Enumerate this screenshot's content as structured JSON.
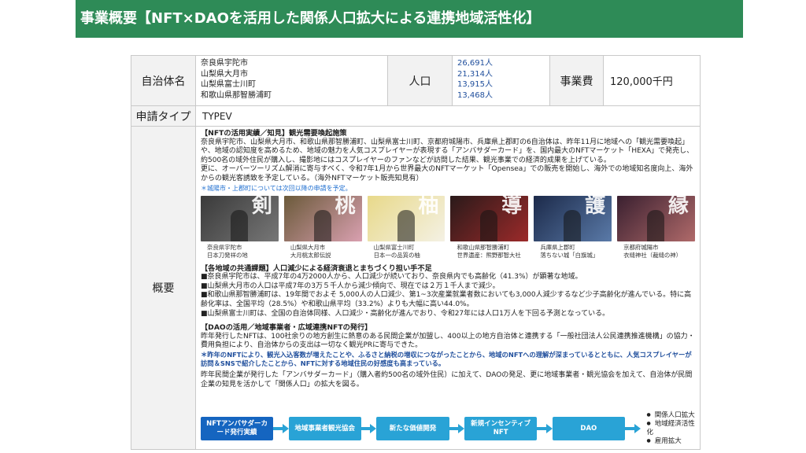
{
  "header": {
    "title": "事業概要【NFT×DAOを活用した関係人口拡大による連携地域活性化】"
  },
  "table": {
    "municipality_label": "自治体名",
    "municipalities": [
      "奈良県宇陀市",
      "山梨県大月市",
      "山梨県富士川町",
      "和歌山県那智勝浦町"
    ],
    "population_label": "人口",
    "populations": [
      "26,691人",
      "21,314人",
      "13,915人",
      "13,468人"
    ],
    "budget_label": "事業費",
    "budget_value": "120,000千円",
    "type_label": "申請タイプ",
    "type_value": "TYPEV",
    "overview_label": "概要"
  },
  "overview": {
    "s1_title": "【NFTの活用実績／知見】観光需要喚起施策",
    "s1_p1": "奈良県宇陀市、山梨県大月市、和歌山県那智勝浦町、山梨県富士川町、京都府城陽市、兵庫県上郡町の6自治体は、昨年11月に地域への「観光需要喚起」や、地域の認知度を高めるため、地域の魅力を人気コスプレイヤーが表現する「アンバサダーカード」を、国内最大のNFTマーケット「HEXA」で発売し、約500名の域外住民が購入し、撮影地にはコスプレイヤーのファンなどが訪問した結果、観光事業での経済的成果を上げている。",
    "s1_p2": "更に、オーバーツーリズム解消に寄与すべく、令和7年1月から世界最大のNFTマーケット「Opensea」での販売を開始し、海外での地域知名度向上、海外からの観光客誘致を予定している。（海外NFTマーケット販売知見有）",
    "s1_note": "＊城陽市・上郡町については次回以降の申請を予定。",
    "photos": [
      {
        "kanji": "剣",
        "caption1": "奈良県宇陀市",
        "caption2": "日本刀発祥の地",
        "c1": "#3a3a3a",
        "c2": "#777777"
      },
      {
        "kanji": "桃",
        "caption1": "山梨県大月市",
        "caption2": "大月桃太郎伝説",
        "c1": "#6b5a3a",
        "c2": "#d9a0b0"
      },
      {
        "kanji": "柚",
        "caption1": "山梨県富士川町",
        "caption2": "日本一の品質の柚",
        "c1": "#e8d98a",
        "c2": "#f4f1e4"
      },
      {
        "kanji": "導",
        "caption1": "和歌山県那智勝浦町",
        "caption2": "世界遺産：熊野那智大社",
        "c1": "#2a1a1a",
        "c2": "#9c2a2a"
      },
      {
        "kanji": "護",
        "caption1": "兵庫県上郡町",
        "caption2": "落ちない城「白旗城」",
        "c1": "#1c2a4a",
        "c2": "#5a7aa8"
      },
      {
        "kanji": "縁",
        "caption1": "京都府城陽市",
        "caption2": "衣縫神社（裁縫の神）",
        "c1": "#3a2030",
        "c2": "#b06a6a"
      }
    ],
    "s2_title": "【各地域の共通課題】人口減少による経済衰退とまちづくり担い手不足",
    "s2_items": [
      "■奈良県宇陀市は、平成7年の4万2000人から、人口減少が続いており、奈良県内でも高齢化（41.3%）が顕著な地域。",
      "■山梨県大月市の人口は平成7年の3万５千人から減少傾向で、現在では２万１千人まで減少。",
      "■和歌山県那智勝浦町は、19年間でおよそ 5,000人の人口減少、第1~3次産業就業者数においても3,000人減少するなど少子高齢化が進んでいる。特に高齢化率は、全国平均（28.5%）や和歌山県平均（33.2%）よりも大幅に高い44.0%。",
      "■山梨県富士川町は、全国の自治体同様、人口減少・高齢化が進んでおり、令和27年には人口1万人を下回る予測となっている。"
    ],
    "s3_title": "【DAOの活用／地域事業者・広域連携NFTの発行】",
    "s3_p1": "昨年発行したNFTは、100社余りの地方創生に熱意のある民間企業が加盟し、400以上の地方自治体と連携する「一般社団法人公民連携推進機構」の協力・費用負担により、自治体からの支出は一切なく観光PRに寄与できた。",
    "s3_note": "＊昨年のNFTにより、観光入込客数が増えたことや、ふるさと納税の増収につながったことから、地域のNFTへの理解が深まっているとともに、人気コスプレイヤーが訪問＆SNSで紹介したことから、NFTに対する地域住民の好感度も高まっている。",
    "s3_p2": "昨年民間企業が発行した「アンバサダーカード」（購入者約500名の域外住民）に加えて、DAOの発足、更に地域事業者・観光協会を加えて、自治体が民間企業の知見を活かして「関係人口」の拡大を図る。"
  },
  "flow": {
    "steps": [
      "NFTアンバサダーカード発行実績",
      "地域事業者観光協会",
      "新たな価値開発",
      "新規インセンティブNFT",
      "DAO"
    ],
    "outcomes": [
      "関係人口拡大",
      "地域経済活性化",
      "雇用拡大"
    ]
  }
}
